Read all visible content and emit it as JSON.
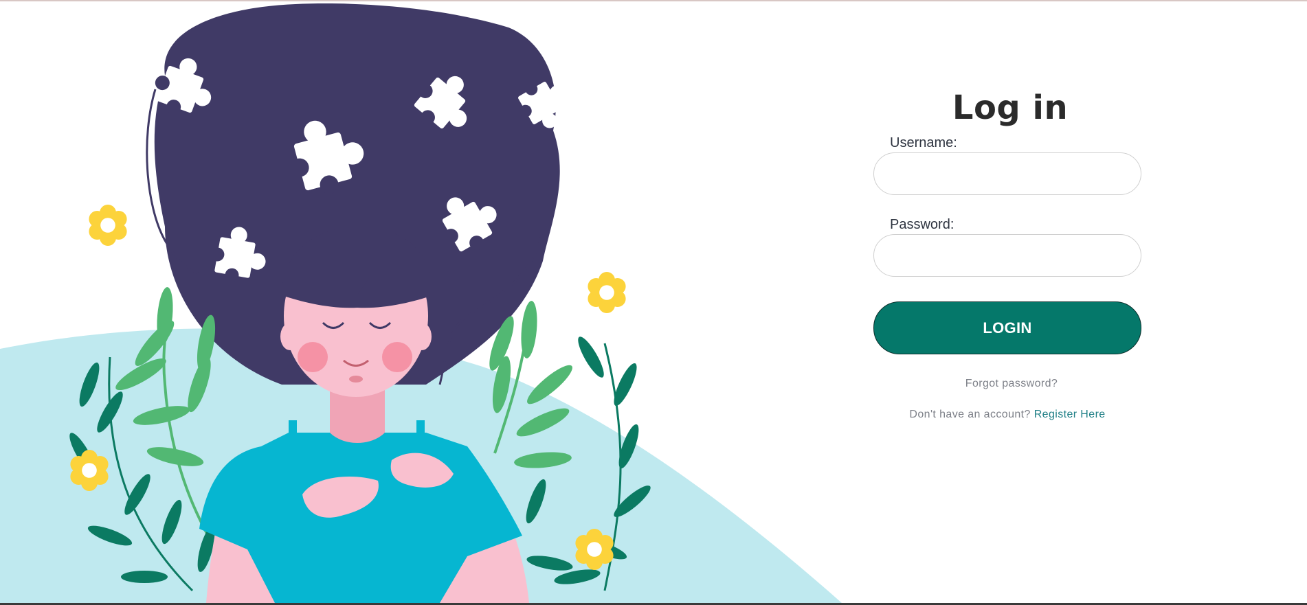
{
  "login": {
    "title": "Log in",
    "username_label": "Username:",
    "username_value": "",
    "password_label": "Password:",
    "password_value": "",
    "login_button": "LOGIN",
    "forgot_password": "Forgot password?",
    "no_account_text": "Don't have an account?",
    "register_link": "Register Here"
  },
  "colors": {
    "accent": "#05786a",
    "link": "#1f7f86",
    "title": "#2b2b2b",
    "hair": "#403a66",
    "background_blob": "#bfe9ef",
    "shirt": "#06b6d1",
    "skin": "#f9c0cf",
    "flower": "#fcd33b",
    "leaf_light": "#52b873",
    "leaf_dark": "#0b7a62"
  },
  "illustration": {
    "subject": "woman-with-puzzle-hair",
    "icons": [
      "puzzle-piece-icon",
      "flower-icon",
      "leaf-branch-icon"
    ]
  }
}
